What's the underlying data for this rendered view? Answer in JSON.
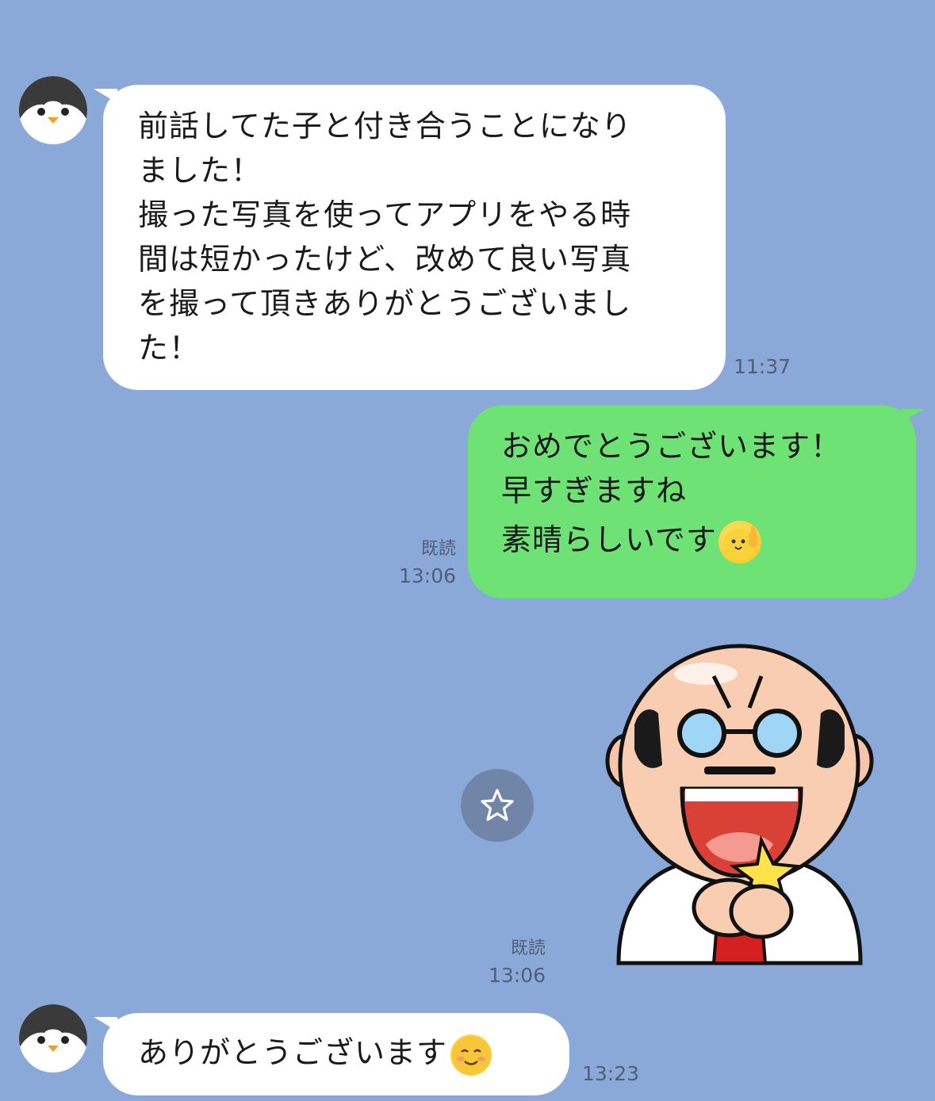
{
  "messages": [
    {
      "side": "in",
      "lines": [
        "前話してた子と付き合うことになり",
        "ました！",
        "撮った写真を使ってアプリをやる時",
        "間は短かったけど、改めて良い写真",
        "を撮って頂きありがとうございまし",
        "た！"
      ],
      "time": "11:37"
    },
    {
      "side": "out",
      "lines": [
        "おめでとうございます！",
        "早すぎますね",
        "素晴らしいです"
      ],
      "read": "既読",
      "time": "13:06",
      "emoji": "thumbs-up-chick-emoji"
    },
    {
      "side": "out",
      "type": "sticker",
      "sticker": "bald-man-happy-sticker",
      "read": "既読",
      "time": "13:06"
    },
    {
      "side": "in",
      "lines": [
        "ありがとうございます"
      ],
      "time": "13:23",
      "emoji": "smiling-face-emoji"
    }
  ],
  "colors": {
    "background": "#8aa9d8",
    "incoming_bubble": "#ffffff",
    "outgoing_bubble": "#6fe276"
  },
  "icons": {
    "avatar": "penguin-avatar-icon",
    "favorite_sticker": "star-icon"
  }
}
